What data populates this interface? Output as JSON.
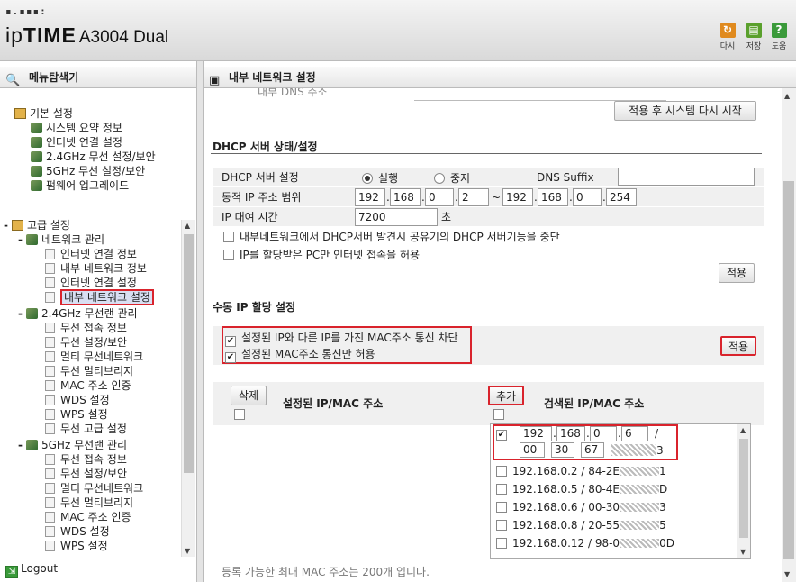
{
  "header": {
    "logo_dots": "▪.▪▪▪:",
    "brand_ip": "ip",
    "brand_time": "TIME",
    "model": "A3004 Dual",
    "toolbar": [
      {
        "icon": "refresh-icon",
        "label": "다시",
        "color": "#e08a1e"
      },
      {
        "icon": "save-icon",
        "label": "저장",
        "color": "#5aa02c"
      },
      {
        "icon": "help-icon",
        "label": "도움",
        "color": "#3a9a3a"
      }
    ]
  },
  "sidebar": {
    "title": "메뉴탐색기",
    "logout": "Logout"
  },
  "tree": {
    "basic": {
      "label": "기본 설정",
      "items": [
        "시스템 요약 정보",
        "인터넷 연결 설정",
        "2.4GHz 무선 설정/보안",
        "5GHz 무선 설정/보안",
        "펌웨어 업그레이드"
      ]
    },
    "advanced": {
      "label": "고급 설정",
      "toggle": "-",
      "network": {
        "label": "네트워크 관리",
        "toggle": "-",
        "items": [
          "인터넷 연결 정보",
          "내부 네트워크 정보",
          "인터넷 연결 설정",
          "내부 네트워크 설정"
        ]
      },
      "wifi24": {
        "label": "2.4GHz 무선랜 관리",
        "toggle": "-",
        "items": [
          "무선 접속 정보",
          "무선 설정/보안",
          "멀티 무선네트워크",
          "무선 멀티브리지",
          "MAC 주소 인증",
          "WDS 설정",
          "WPS 설정",
          "무선 고급 설정"
        ]
      },
      "wifi5": {
        "label": "5GHz 무선랜 관리",
        "toggle": "-",
        "items": [
          "무선 접속 정보",
          "무선 설정/보안",
          "멀티 무선네트워크",
          "무선 멀티브리지",
          "MAC 주소 인증",
          "WDS 설정",
          "WPS 설정"
        ]
      }
    }
  },
  "content": {
    "title": "내부 네트워크 설정",
    "dns_partial": "내부 DNS 주소",
    "apply_restart": "적용 후 시스템 다시 시작",
    "dhcp_section": "DHCP 서버 상태/설정",
    "dhcp_server_label": "DHCP 서버 설정",
    "dhcp_on": "실행",
    "dhcp_off": "중지",
    "dns_suffix_label": "DNS Suffix",
    "dns_suffix_value": "",
    "range_label": "동적 IP 주소 범위",
    "range_start": [
      "192",
      "168",
      "0",
      "2"
    ],
    "range_sep": "~",
    "range_end": [
      "192",
      "168",
      "0",
      "254"
    ],
    "lease_label": "IP 대여 시간",
    "lease_value": "7200",
    "lease_unit": "초",
    "opt1": "내부네트워크에서 DHCP서버 발견시 공유기의 DHCP 서버기능을 중단",
    "opt2": "IP를 할당받은 PC만 인터넷 접속을 허용",
    "apply": "적용",
    "manual_section": "수동 IP 할당 설정",
    "manual_opt1": "설정된 IP와 다른 IP를 가진 MAC주소 통신 차단",
    "manual_opt2": "설정된 MAC주소 통신만 허용",
    "apply2": "적용",
    "delete": "삭제",
    "configured_label": "설정된 IP/MAC 주소",
    "add": "추가",
    "scanned_label": "검색된 IP/MAC 주소",
    "new_ip": [
      "192",
      "168",
      "0",
      "6"
    ],
    "ip_slash": "/",
    "new_mac": [
      "00",
      "30",
      "67",
      "",
      "",
      "3"
    ],
    "scanned": [
      "192.168.0.2 / 84-2E",
      "1",
      "192.168.0.5 / 80-4E",
      "D",
      "192.168.0.6 / 00-30",
      "3",
      "192.168.0.8 / 20-55",
      "5",
      "192.168.0.12 / 98-0",
      "0D"
    ],
    "footer": "등록 가능한 최대 MAC 주소는 200개 입니다."
  },
  "colors": {
    "highlight": "#d9232c",
    "selection": "#d9dff2"
  }
}
